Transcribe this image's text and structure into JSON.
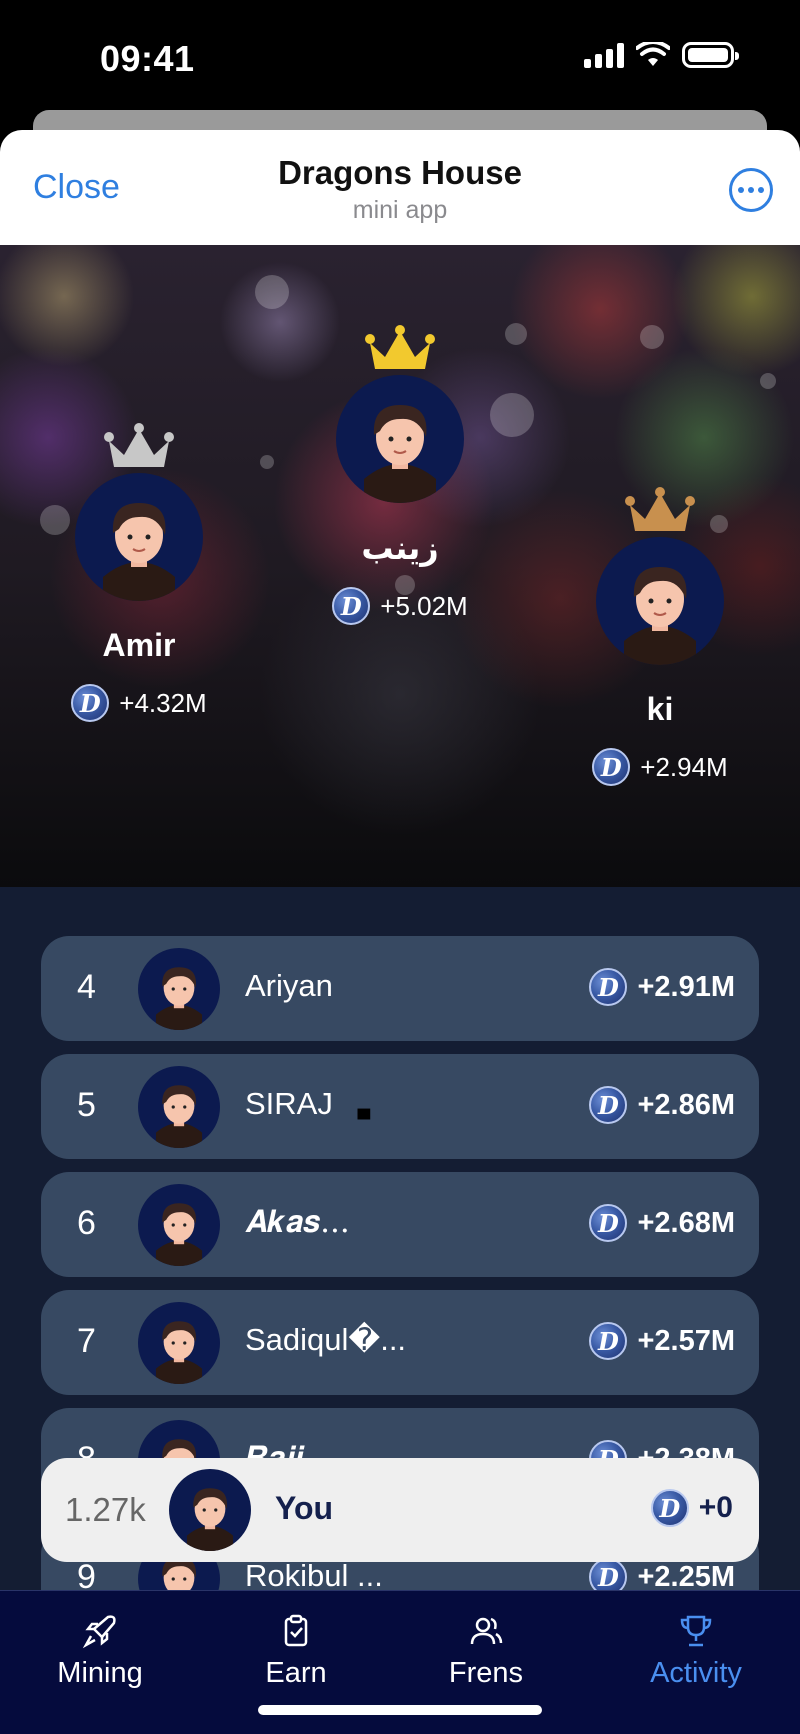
{
  "status_bar": {
    "time": "09:41"
  },
  "header": {
    "close_label": "Close",
    "title": "Dragons House",
    "subtitle": "mini app"
  },
  "podium": [
    {
      "rank": 1,
      "name": "زينب",
      "score": "+5.02M",
      "crown_color": "#f2c92e"
    },
    {
      "rank": 2,
      "name": "Amir",
      "score": "+4.32M",
      "crown_color": "#c7c7c7"
    },
    {
      "rank": 3,
      "name": "ki",
      "score": "+2.94M",
      "crown_color": "#c8904e"
    }
  ],
  "coin_symbol": "D",
  "leaderboard": [
    {
      "rank": "4",
      "name": "Ariyan",
      "score": "+2.91M"
    },
    {
      "rank": "5",
      "name": "SIRAJ",
      "name_suffix": "▄",
      "score": "+2.86M"
    },
    {
      "rank": "6",
      "name": "𝑨𝒌𝒂𝒔...",
      "score": "+2.68M"
    },
    {
      "rank": "7",
      "name": "Sadiqul�...",
      "score": "+2.57M"
    },
    {
      "rank": "8",
      "name": "𝑹𝒂𝒋𝒊...",
      "score": "+2.38M"
    },
    {
      "rank": "9",
      "name": "Rokibul ...",
      "score": "+2.25M"
    }
  ],
  "you": {
    "rank": "1.27k",
    "name": "You",
    "score": "+0"
  },
  "nav": [
    {
      "label": "Mining",
      "icon": "rocket-icon",
      "active": false
    },
    {
      "label": "Earn",
      "icon": "clipboard-check-icon",
      "active": false
    },
    {
      "label": "Frens",
      "icon": "users-icon",
      "active": false
    },
    {
      "label": "Activity",
      "icon": "trophy-icon",
      "active": true
    }
  ],
  "colors": {
    "accent": "#2f7fe0",
    "nav_active": "#4a8ff0",
    "nav_bg": "#050b3d",
    "row_bg": "#374962",
    "list_bg": "#141d33"
  }
}
